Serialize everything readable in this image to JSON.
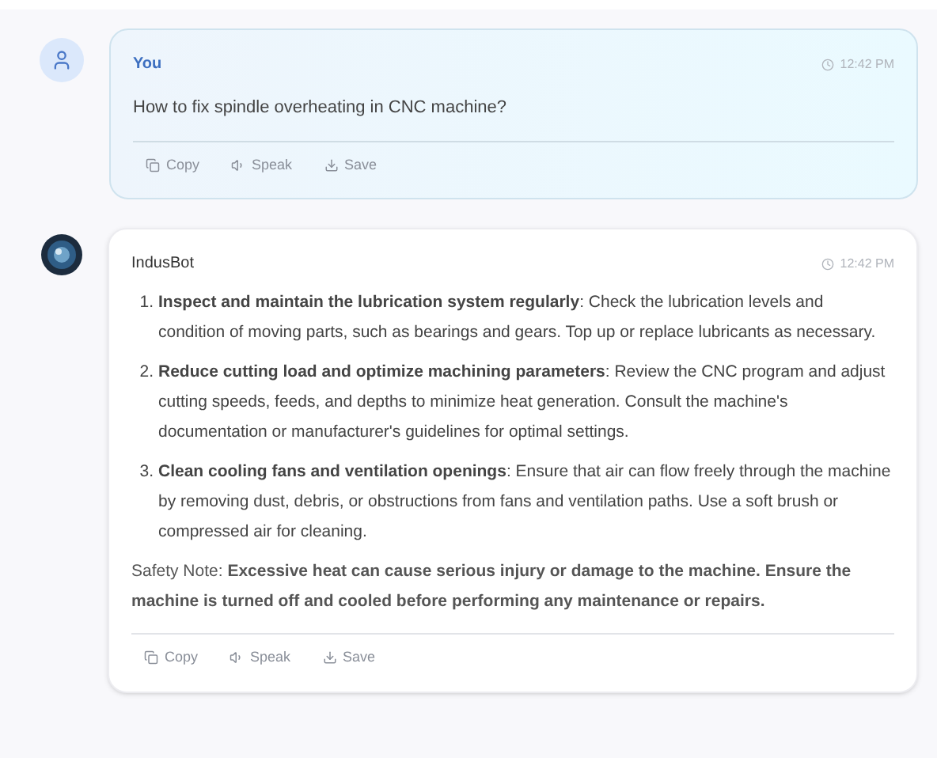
{
  "messages": [
    {
      "kind": "user",
      "sender": "You",
      "time": "12:42 PM",
      "text": "How to fix spindle overheating in CNC machine?",
      "actions": [
        "Copy",
        "Speak",
        "Save"
      ]
    },
    {
      "kind": "bot",
      "sender": "IndusBot",
      "time": "12:42 PM",
      "items": [
        {
          "number": "1.",
          "text": "**Inspect and maintain the lubrication system regularly**: Check the lubrication levels and condition of moving parts, such as bearings and gears. Top up or replace lubricants as necessary."
        },
        {
          "number": "2.",
          "text": "**Reduce cutting load and optimize machining parameters**: Review the CNC program and adjust cutting speeds, feeds, and depths to minimize heat generation. Consult the machine's documentation or manufacturer's guidelines for optimal settings."
        },
        {
          "number": "3.",
          "text": "**Clean cooling fans and ventilation openings**: Ensure that air can flow freely through the machine by removing dust, debris, or obstructions from fans and ventilation paths. Use a soft brush or compressed air for cleaning."
        }
      ],
      "note": "Safety Note: **Excessive heat can cause serious injury or damage to the machine. Ensure the machine is turned off and cooled before performing any maintenance or repairs.**",
      "actions": [
        "Copy",
        "Speak",
        "Save"
      ]
    }
  ]
}
